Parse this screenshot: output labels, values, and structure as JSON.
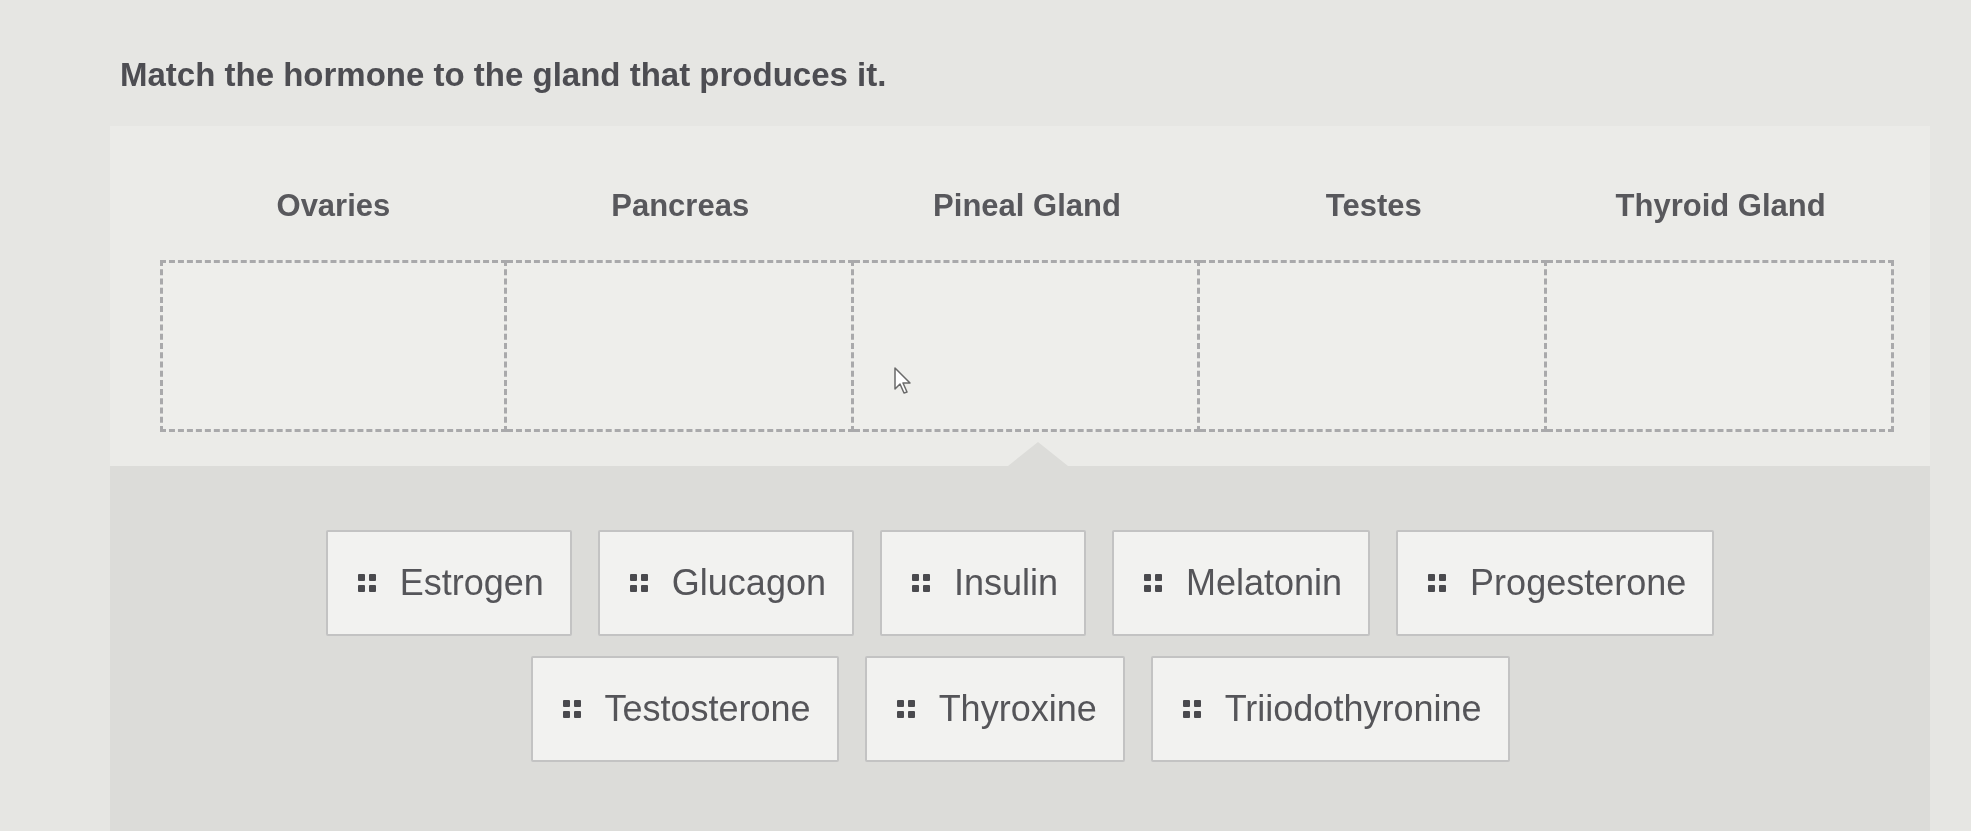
{
  "question": {
    "text": "Match the hormone to the gland that produces it."
  },
  "targets": [
    {
      "label": "Ovaries"
    },
    {
      "label": "Pancreas"
    },
    {
      "label": "Pineal Gland"
    },
    {
      "label": "Testes"
    },
    {
      "label": "Thyroid Gland"
    }
  ],
  "answer_rows": [
    [
      {
        "label": "Estrogen"
      },
      {
        "label": "Glucagon"
      },
      {
        "label": "Insulin"
      },
      {
        "label": "Melatonin"
      },
      {
        "label": "Progesterone"
      }
    ],
    [
      {
        "label": "Testosterone"
      },
      {
        "label": "Thyroxine"
      },
      {
        "label": "Triiodothyronine"
      }
    ]
  ]
}
